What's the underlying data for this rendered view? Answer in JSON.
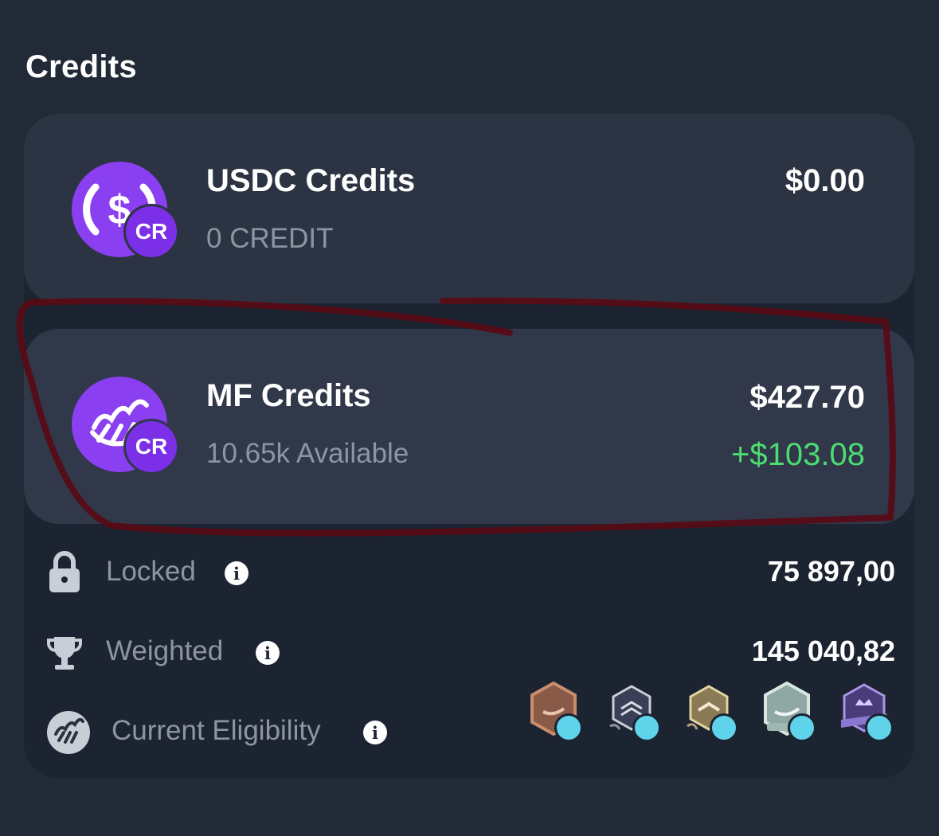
{
  "header": {
    "title": "Credits"
  },
  "cards": [
    {
      "name": "USDC Credits",
      "sub": "0 CREDIT",
      "value": "$0.00",
      "change": "",
      "badge": "CR",
      "icon": "usdc-coin-icon"
    },
    {
      "name": "MF Credits",
      "sub": "10.65k Available",
      "value": "$427.70",
      "change": "+$103.08",
      "badge": "CR",
      "icon": "mf-coin-icon"
    }
  ],
  "stats": [
    {
      "label": "Locked",
      "value": "75 897,00",
      "icon": "lock-icon"
    },
    {
      "label": "Weighted",
      "value": "145 040,82",
      "icon": "trophy-icon"
    },
    {
      "label": "Current Eligibility",
      "value": "",
      "icon": "mf-logo-icon"
    }
  ],
  "eligibility_badges": [
    "bronze-rank-badge",
    "silver-rank-badge",
    "gold-rank-badge",
    "platinum-rank-badge",
    "diamond-rank-badge"
  ],
  "colors": {
    "background": "#222a38",
    "card": "#2c3443",
    "accent_purple": "#8a3ff0",
    "positive_green": "#4ddc73",
    "annotation_red": "#5a0a14"
  }
}
